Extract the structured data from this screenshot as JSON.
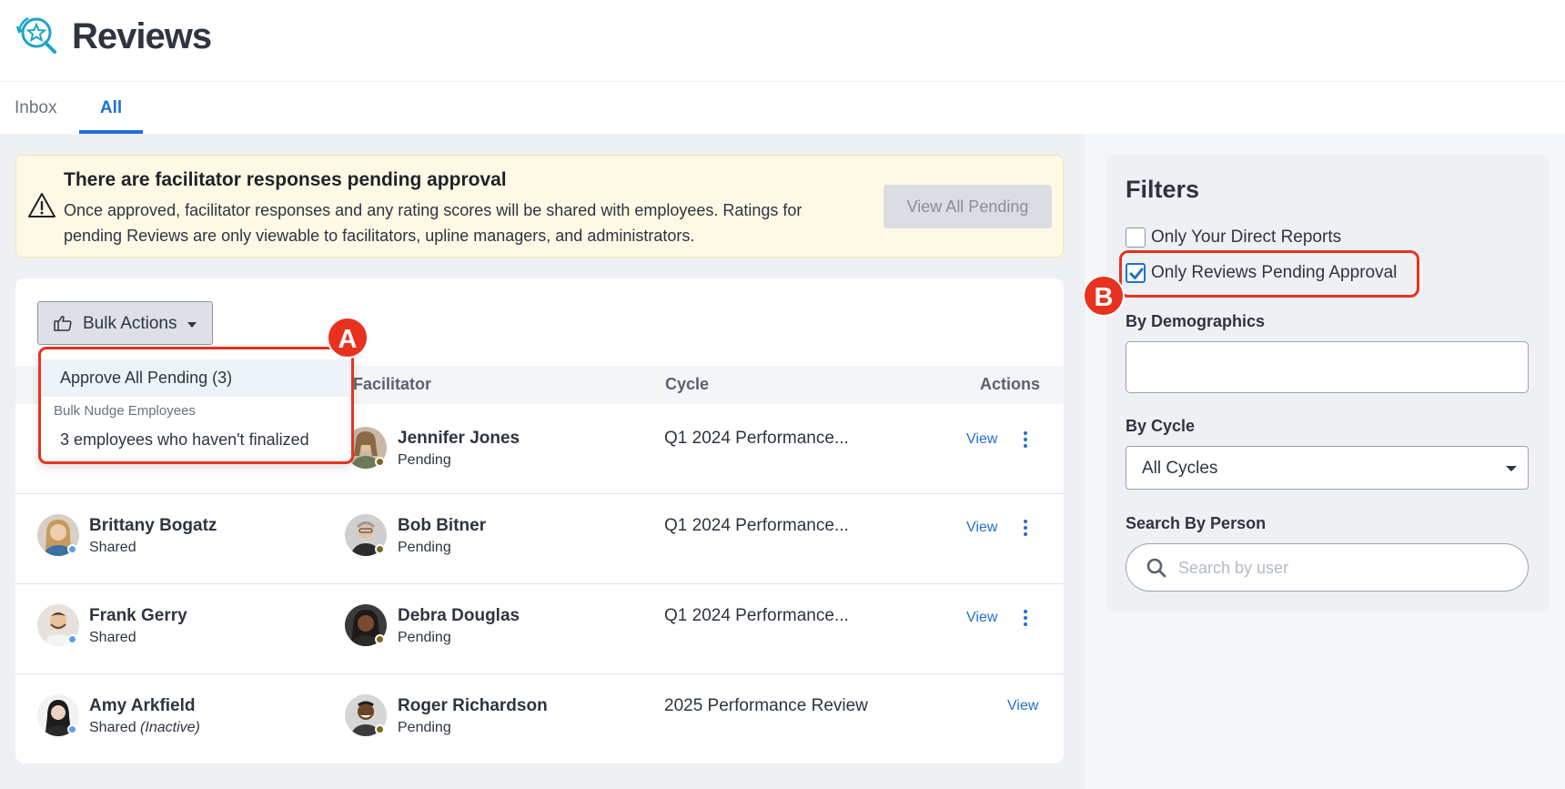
{
  "app": {
    "title": "Reviews",
    "logo_icon": "star-magnifier-icon"
  },
  "tabs": [
    {
      "label": "Inbox",
      "active": false
    },
    {
      "label": "All",
      "active": true
    }
  ],
  "alert": {
    "icon": "warning-triangle-icon",
    "title": "There are facilitator responses pending approval",
    "body": "Once approved, facilitator responses and any rating scores will be shared with employees. Ratings for pending Reviews are only viewable to facilitators, upline managers, and administrators.",
    "button_label": "View All Pending"
  },
  "bulk_actions": {
    "label": "Bulk Actions",
    "menu": {
      "approve_label": "Approve All Pending (3)",
      "group_label": "Bulk Nudge Employees",
      "nudge_label": "3 employees who haven't finalized"
    }
  },
  "table": {
    "columns": {
      "facilitator": "Facilitator",
      "cycle": "Cycle",
      "actions": "Actions"
    },
    "rows": [
      {
        "employee": "",
        "employee_status": "",
        "facilitator": "Jennifer Jones",
        "facilitator_status": "Pending",
        "cycle": "Q1 2024 Performance...",
        "view_label": "View",
        "has_menu": true
      },
      {
        "employee": "Brittany Bogatz",
        "employee_status": "Shared",
        "facilitator": "Bob Bitner",
        "facilitator_status": "Pending",
        "cycle": "Q1 2024 Performance...",
        "view_label": "View",
        "has_menu": true
      },
      {
        "employee": "Frank Gerry",
        "employee_status": "Shared",
        "facilitator": "Debra Douglas",
        "facilitator_status": "Pending",
        "cycle": "Q1 2024 Performance...",
        "view_label": "View",
        "has_menu": true
      },
      {
        "employee": "Amy Arkfield",
        "employee_status": "Shared",
        "employee_status_note": "(Inactive)",
        "facilitator": "Roger Richardson",
        "facilitator_status": "Pending",
        "cycle": "2025 Performance Review",
        "view_label": "View",
        "has_menu": false
      }
    ]
  },
  "annotations": {
    "a": "A",
    "b": "B"
  },
  "filters": {
    "title": "Filters",
    "direct_reports": {
      "label": "Only Your Direct Reports",
      "checked": false
    },
    "pending_approval": {
      "label": "Only Reviews Pending Approval",
      "checked": true
    },
    "demographics_label": "By Demographics",
    "demographics_value": "",
    "cycle_label": "By Cycle",
    "cycle_value": "All Cycles",
    "search_label": "Search By Person",
    "search_placeholder": "Search by user"
  },
  "colors": {
    "accent": "#1f6fd6",
    "annotation_red": "#e8321f",
    "alert_bg": "#fef9e5",
    "online_dot": "#5b9cf2",
    "pending_dot": "#7a6a1a"
  }
}
